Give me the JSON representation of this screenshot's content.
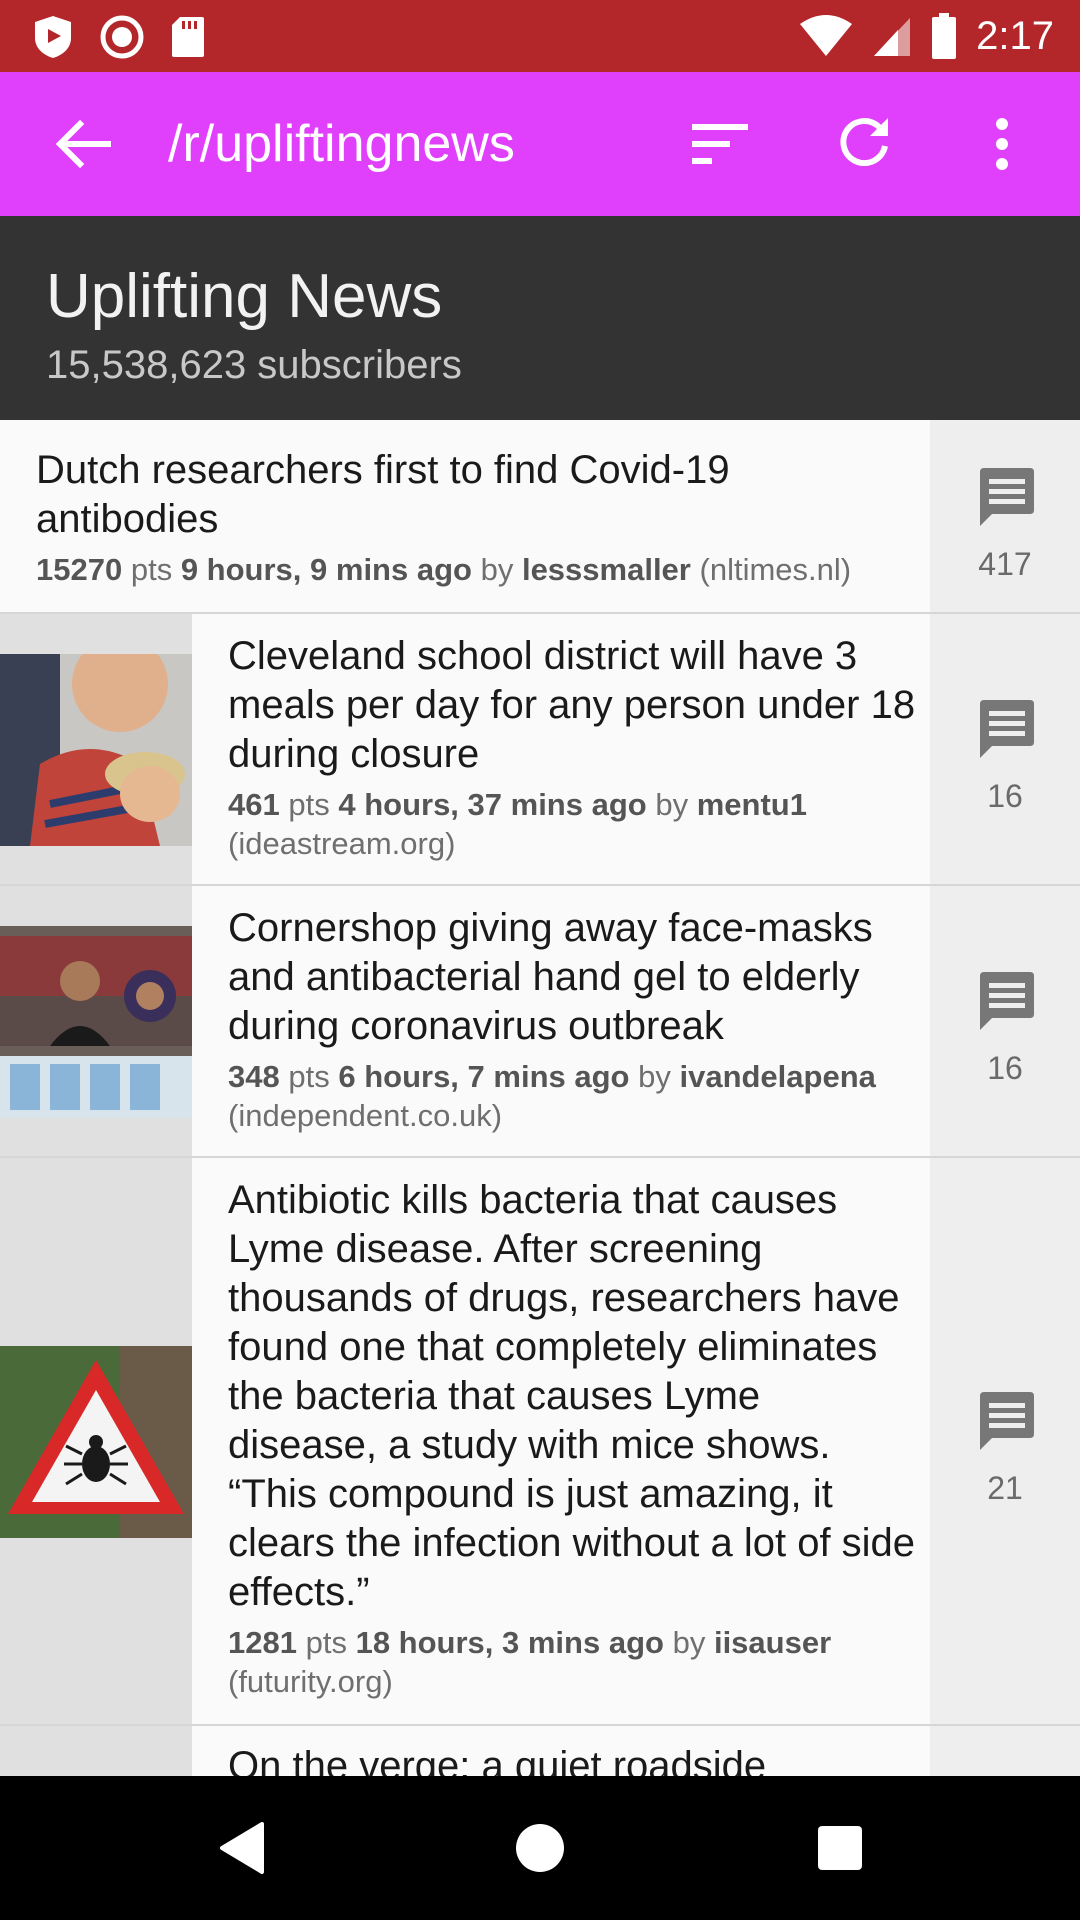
{
  "status_bar": {
    "time": "2:17",
    "left_icons": [
      "shield-icon",
      "record-icon",
      "sd-card-icon"
    ],
    "right_icons": [
      "wifi-icon",
      "cell-signal-icon",
      "battery-icon"
    ],
    "color": "#b3272a"
  },
  "app_bar": {
    "title": "/r/upliftingnews",
    "color": "#e040fb",
    "icons": [
      "back-arrow-icon",
      "sort-icon",
      "refresh-icon",
      "more-vert-icon"
    ]
  },
  "subreddit": {
    "name": "Uplifting News",
    "subscribers": "15,538,623 subscribers"
  },
  "posts": [
    {
      "title": "Dutch researchers first to find Covid-19 antibodies",
      "points": "15270",
      "pts_label": "pts",
      "age": "9 hours, 9 mins ago",
      "by_label": "by",
      "author": "lesssmaller",
      "domain": "(nltimes.nl)",
      "comments": "417",
      "has_thumbnail": false
    },
    {
      "title": "Cleveland school district will have 3 meals per day for any person under 18 during closure",
      "points": "461",
      "pts_label": "pts",
      "age": "4 hours, 37 mins ago",
      "by_label": "by",
      "author": "mentu1",
      "domain": "(ideastream.org)",
      "comments": "16",
      "has_thumbnail": true
    },
    {
      "title": "Cornershop giving away face-masks and antibacterial hand gel to elderly during coronavirus outbreak",
      "points": "348",
      "pts_label": "pts",
      "age": "6 hours, 7 mins ago",
      "by_label": "by",
      "author": "ivandelapena",
      "domain": "(independent.co.uk)",
      "comments": "16",
      "has_thumbnail": true
    },
    {
      "title": "Antibiotic kills bacteria that causes Lyme disease. After screening thousands of drugs, researchers have found one that completely eliminates the bacteria that causes Lyme disease, a study with mice shows. “This compound is just amazing, it clears the infection without a lot of side effects.”",
      "points": "1281",
      "pts_label": "pts",
      "age": "18 hours, 3 mins ago",
      "by_label": "by",
      "author": "iisauser",
      "domain": "(futurity.org)",
      "comments": "21",
      "has_thumbnail": true
    },
    {
      "title": "On the verge: a quiet roadside"
    }
  ],
  "nav_bar": {
    "icons": [
      "back-triangle-icon",
      "home-circle-icon",
      "recents-square-icon"
    ]
  }
}
